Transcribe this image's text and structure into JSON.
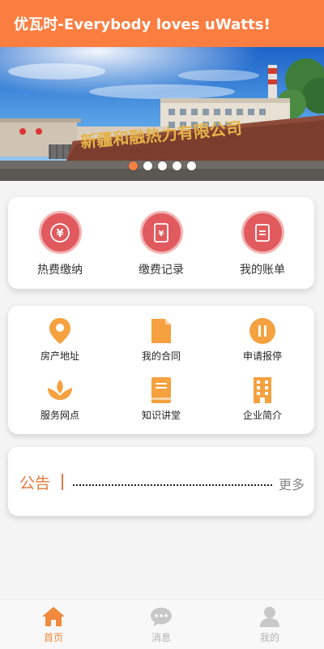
{
  "header": {
    "title": "优瓦时-Everybody loves uWatts!"
  },
  "banner": {
    "sign_text": "新疆和融热力有限公司",
    "slide_count": 5,
    "active_slide": 1
  },
  "payment": {
    "items": [
      {
        "label": "热费缴纳",
        "icon": "yuan-coin-icon"
      },
      {
        "label": "缴费记录",
        "icon": "payment-record-icon"
      },
      {
        "label": "我的账单",
        "icon": "bill-icon"
      }
    ]
  },
  "services": {
    "items": [
      {
        "label": "房产地址",
        "icon": "location-pin-icon"
      },
      {
        "label": "我的合同",
        "icon": "document-icon"
      },
      {
        "label": "申请报停",
        "icon": "pause-icon"
      },
      {
        "label": "服务网点",
        "icon": "lotus-icon"
      },
      {
        "label": "知识讲堂",
        "icon": "book-icon"
      },
      {
        "label": "企业简介",
        "icon": "building-icon"
      }
    ]
  },
  "notice": {
    "title": "公告",
    "more": "更多"
  },
  "tabbar": {
    "items": [
      {
        "label": "首页",
        "icon": "home-icon",
        "active": true
      },
      {
        "label": "消息",
        "icon": "message-icon",
        "active": false
      },
      {
        "label": "我的",
        "icon": "profile-icon",
        "active": false
      }
    ]
  },
  "colors": {
    "brand": "#fb7e41",
    "payment_icon": "#e05a5e",
    "service_icon": "#f5a13f",
    "tab_inactive": "#c8c8c8"
  }
}
